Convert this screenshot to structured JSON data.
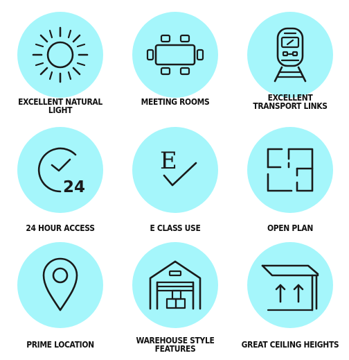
{
  "colors": {
    "circle": "#a5f6fb",
    "icon": "#1a1a1a",
    "text": "#111111"
  },
  "features": [
    {
      "label": "EXCELLENT NATURAL LIGHT",
      "icon": "sun-icon"
    },
    {
      "label": "MEETING ROOMS",
      "icon": "meeting-table-icon"
    },
    {
      "label": "EXCELLENT\nTRANSPORT LINKS",
      "icon": "train-icon"
    },
    {
      "label": "24 HOUR ACCESS",
      "icon": "clock-24-icon"
    },
    {
      "label": "E CLASS USE",
      "icon": "e-class-check-icon"
    },
    {
      "label": "OPEN PLAN",
      "icon": "floor-plan-icon"
    },
    {
      "label": "PRIME LOCATION",
      "icon": "location-pin-icon"
    },
    {
      "label": "WAREHOUSE STYLE\nFEATURES",
      "icon": "warehouse-icon"
    },
    {
      "label": "GREAT CEILING HEIGHTS",
      "icon": "ceiling-height-icon"
    }
  ],
  "e_class_letter": "E",
  "clock_number": "24"
}
